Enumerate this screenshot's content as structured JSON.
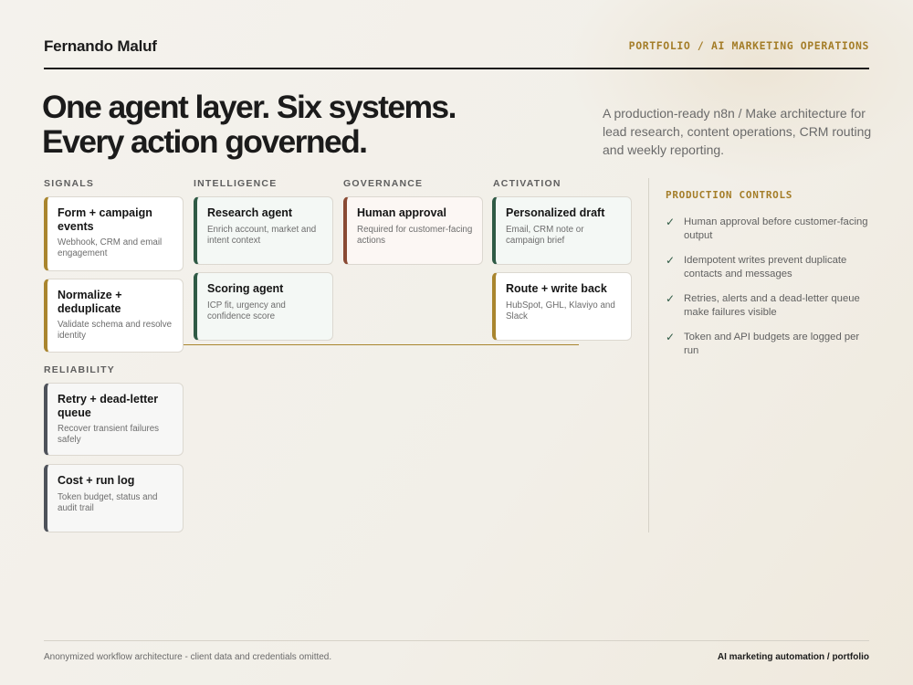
{
  "header": {
    "brand": "Fernando Maluf",
    "breadcrumb": "PORTFOLIO / AI MARKETING OPERATIONS"
  },
  "hero": {
    "title_line1": "One agent layer. Six systems.",
    "title_line2": "Every action governed.",
    "subtitle": "A production-ready n8n / Make architecture for lead research, content operations, CRM routing and weekly reporting."
  },
  "columns": {
    "signals": {
      "label": "SIGNALS",
      "cards": [
        {
          "title": "Form + campaign events",
          "desc": "Webhook, CRM and email engagement"
        },
        {
          "title": "Normalize + deduplicate",
          "desc": "Validate schema and resolve identity"
        }
      ]
    },
    "intelligence": {
      "label": "INTELLIGENCE",
      "cards": [
        {
          "title": "Research agent",
          "desc": "Enrich account, market and intent context"
        },
        {
          "title": "Scoring agent",
          "desc": "ICP fit, urgency and confidence score"
        }
      ]
    },
    "governance": {
      "label": "GOVERNANCE",
      "cards": [
        {
          "title": "Human approval",
          "desc": "Required for customer-facing actions"
        }
      ]
    },
    "activation": {
      "label": "ACTIVATION",
      "cards": [
        {
          "title": "Personalized draft",
          "desc": "Email, CRM note or campaign brief"
        },
        {
          "title": "Route + write back",
          "desc": "HubSpot, GHL, Klaviyo and Slack"
        }
      ]
    },
    "reliability": {
      "label": "RELIABILITY",
      "cards": [
        {
          "title": "Retry + dead-letter queue",
          "desc": "Recover transient failures safely"
        },
        {
          "title": "Cost + run log",
          "desc": "Token budget, status and audit trail"
        }
      ]
    }
  },
  "production_controls": {
    "title": "PRODUCTION CONTROLS",
    "check_icon": "✓",
    "items": [
      "Human approval before customer-facing output",
      "Idempotent writes prevent duplicate contacts and messages",
      "Retries, alerts and a dead-letter queue make failures visible",
      "Token and API budgets are logged per run"
    ]
  },
  "footer": {
    "left": "Anonymized workflow architecture - client data and credentials omitted.",
    "right": "AI marketing automation / portfolio"
  },
  "colors": {
    "accent_gold": "#a9852e",
    "agent_green": "#2f5a45",
    "governance_rust": "#8a4a34",
    "reliability_slate": "#4e525a"
  }
}
